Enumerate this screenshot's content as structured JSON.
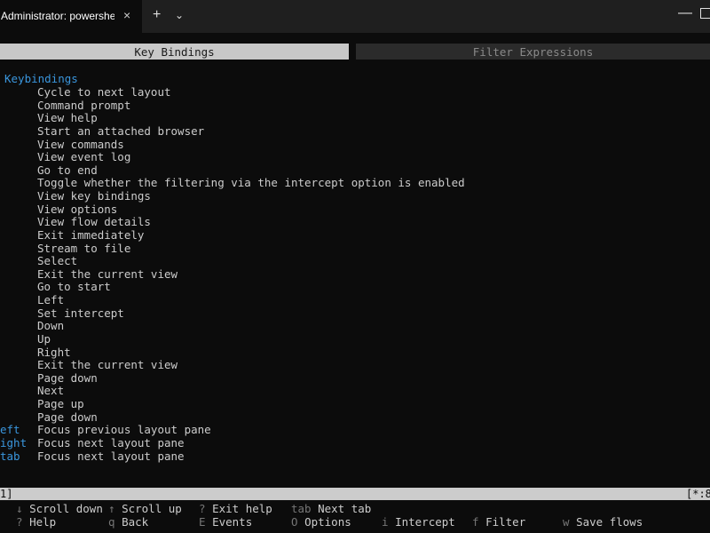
{
  "window": {
    "tab_title": "Administrator: powershell.exe",
    "tab_close_icon": "×",
    "new_tab_icon": "+",
    "dropdown_icon": "⌄",
    "minimize_icon": "—"
  },
  "app_tabs": {
    "active": "Key Bindings",
    "inactive": "Filter Expressions"
  },
  "section_heading": "Keybindings",
  "bindings": [
    {
      "key": "",
      "desc": "Cycle to next layout"
    },
    {
      "key": "",
      "desc": "Command prompt"
    },
    {
      "key": "",
      "desc": "View help"
    },
    {
      "key": "",
      "desc": "Start an attached browser"
    },
    {
      "key": "",
      "desc": "View commands"
    },
    {
      "key": "",
      "desc": "View event log"
    },
    {
      "key": "",
      "desc": "Go to end"
    },
    {
      "key": "",
      "desc": "Toggle whether the filtering via the intercept option is enabled"
    },
    {
      "key": "",
      "desc": "View key bindings"
    },
    {
      "key": "",
      "desc": "View options"
    },
    {
      "key": "",
      "desc": "View flow details"
    },
    {
      "key": "",
      "desc": "Exit immediately"
    },
    {
      "key": "",
      "desc": "Stream to file"
    },
    {
      "key": "",
      "desc": "Select"
    },
    {
      "key": "",
      "desc": "Exit the current view"
    },
    {
      "key": "",
      "desc": "Go to start"
    },
    {
      "key": "",
      "desc": "Left"
    },
    {
      "key": "",
      "desc": "Set intercept"
    },
    {
      "key": "",
      "desc": "Down"
    },
    {
      "key": "",
      "desc": "Up"
    },
    {
      "key": "",
      "desc": "Right"
    },
    {
      "key": "",
      "desc": "Exit the current view"
    },
    {
      "key": "",
      "desc": "Page down"
    },
    {
      "key": "",
      "desc": "Next"
    },
    {
      "key": "",
      "desc": "Page up"
    },
    {
      "key": "",
      "desc": "Page down"
    },
    {
      "key": "eft",
      "desc": "Focus previous layout pane"
    },
    {
      "key": "ight",
      "desc": "Focus next layout pane"
    },
    {
      "key": "tab",
      "desc": "Focus next layout pane"
    }
  ],
  "statusbar": {
    "left": "1]",
    "right": "[*:8"
  },
  "hints": [
    {
      "key": "↓",
      "label": "Scroll down"
    },
    {
      "key": "↑",
      "label": "Scroll up"
    },
    {
      "key": "?",
      "label": "Exit help"
    },
    {
      "key": "tab",
      "label": "Next tab"
    },
    {
      "key": "?",
      "label": "Help"
    },
    {
      "key": "q",
      "label": "Back"
    },
    {
      "key": "E",
      "label": "Events"
    },
    {
      "key": "O",
      "label": "Options"
    },
    {
      "key": "i",
      "label": "Intercept"
    },
    {
      "key": "f",
      "label": "Filter"
    },
    {
      "key": "w",
      "label": "Save flows"
    }
  ]
}
